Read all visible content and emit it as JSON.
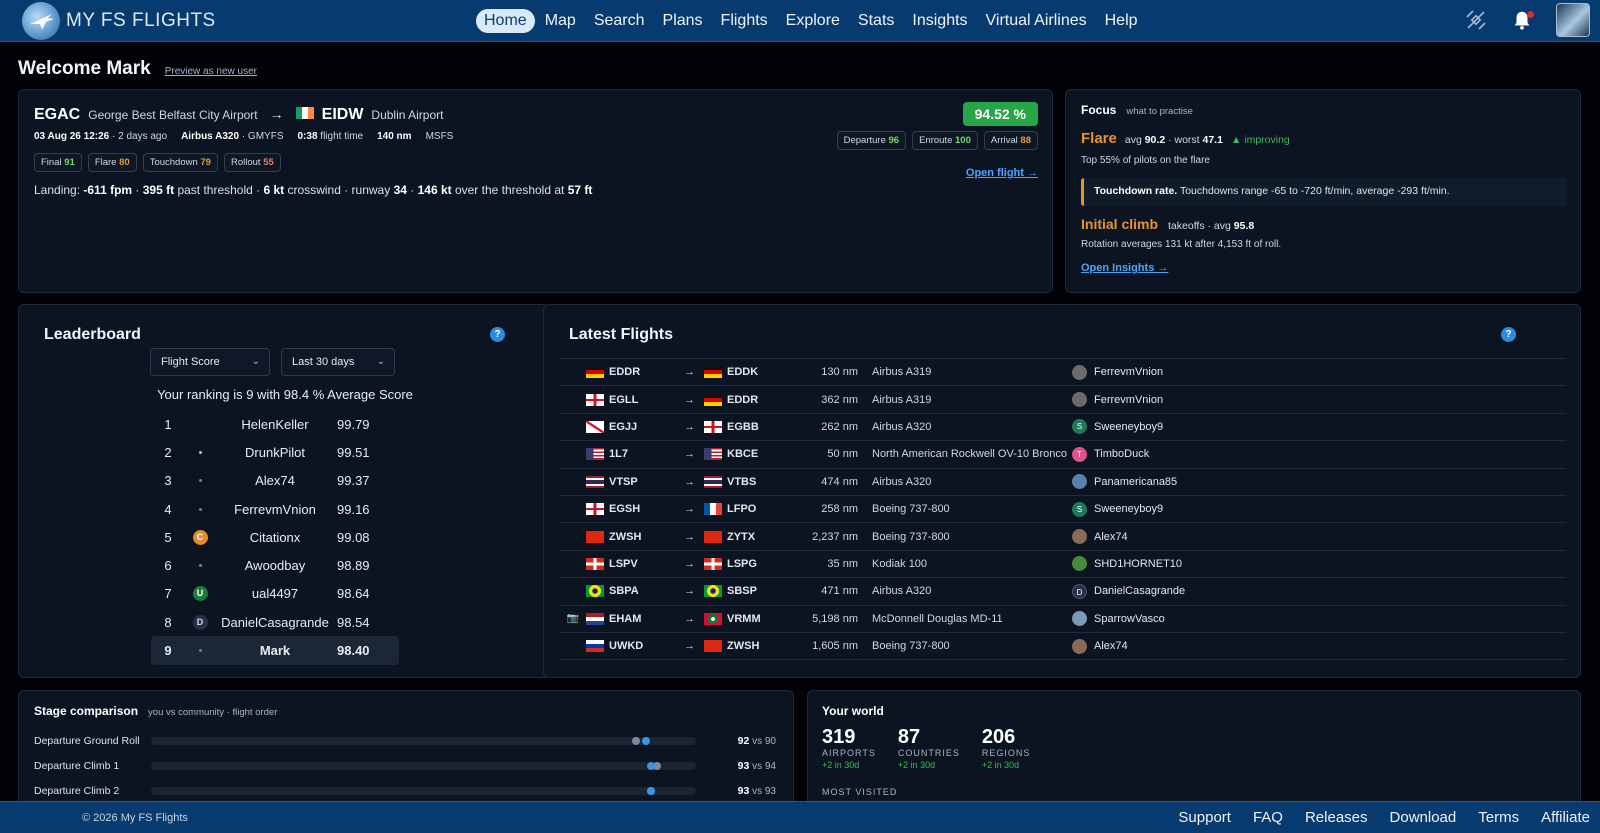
{
  "app": {
    "name": "MY FS FLIGHTS"
  },
  "nav": {
    "items": [
      "Home",
      "Map",
      "Search",
      "Plans",
      "Flights",
      "Explore",
      "Stats",
      "Insights",
      "Virtual Airlines",
      "Help"
    ],
    "active": "Home"
  },
  "welcome": {
    "title": "Welcome Mark",
    "link": "Preview as new user"
  },
  "last_flight": {
    "from_icao": "EGAC",
    "from_name": "George Best Belfast City Airport",
    "to_icao": "EIDW",
    "to_name": "Dublin Airport",
    "date": "03 Aug 26 12:26",
    "ago": "· 2 days ago",
    "aircraft": "Airbus A320",
    "reg": "· GMYFS",
    "duration": "0:38",
    "duration_label": "flight time",
    "distance": "140 nm",
    "sim": "MSFS",
    "score": "94.52 %",
    "chips": [
      {
        "label": "Final",
        "value": "91",
        "tone": "g"
      },
      {
        "label": "Flare",
        "value": "80",
        "tone": "o"
      },
      {
        "label": "Touchdown",
        "value": "79",
        "tone": "o"
      },
      {
        "label": "Rollout",
        "value": "55",
        "tone": "r"
      }
    ],
    "phases": [
      {
        "label": "Departure",
        "value": "96",
        "tone": "g"
      },
      {
        "label": "Enroute",
        "value": "100",
        "tone": "g"
      },
      {
        "label": "Arrival",
        "value": "88",
        "tone": "o"
      }
    ],
    "landing": {
      "p1": "Landing: ",
      "fpm": "-611 fpm",
      "p2": " · ",
      "thr": "395 ft",
      "p3": " past threshold · ",
      "xw": "6 kt",
      "p4": " crosswind · runway ",
      "rwy": "34",
      "p5": " · ",
      "spd": "146 kt",
      "p6": " over the threshold at ",
      "alt": "57 ft"
    },
    "open_link": "Open flight →"
  },
  "focus": {
    "title": "Focus",
    "subtitle": "what to practise",
    "flare": {
      "name": "Flare",
      "avg_label": "avg",
      "avg": "90.2",
      "worst_label": "· worst",
      "worst": "47.1",
      "trend": "▲ improving"
    },
    "top": "Top 55% of pilots on the flare",
    "tip": {
      "bold": "Touchdown rate.",
      "text": " Touchdowns range -65 to -720 ft/min, average -293 ft/min."
    },
    "climb": {
      "name": "Initial climb",
      "text": "takeoffs · avg",
      "avg": "95.8"
    },
    "rotation": "Rotation averages 131 kt after 4,153 ft of roll.",
    "open_link": "Open Insights →"
  },
  "leaderboard": {
    "title": "Leaderboard",
    "metric": "Flight Score",
    "period": "Last 30 days",
    "ranking_text": "Your ranking is 9 with 98.4 % Average Score",
    "rows": [
      {
        "pos": "1",
        "name": "HelenKeller",
        "score": "99.79",
        "av": "none"
      },
      {
        "pos": "2",
        "name": "DrunkPilot",
        "score": "99.51",
        "av": "dot-y"
      },
      {
        "pos": "3",
        "name": "Alex74",
        "score": "99.37",
        "av": "dot"
      },
      {
        "pos": "4",
        "name": "FerrevmVnion",
        "score": "99.16",
        "av": "dot"
      },
      {
        "pos": "5",
        "name": "Citationx",
        "score": "99.08",
        "av": "C"
      },
      {
        "pos": "6",
        "name": "Awoodbay",
        "score": "98.89",
        "av": "dot"
      },
      {
        "pos": "7",
        "name": "ual4497",
        "score": "98.64",
        "av": "U"
      },
      {
        "pos": "8",
        "name": "DanielCasagrande",
        "score": "98.54",
        "av": "D"
      },
      {
        "pos": "9",
        "name": "Mark",
        "score": "98.40",
        "av": "dot"
      }
    ]
  },
  "latest_flights": {
    "title": "Latest Flights",
    "rows": [
      {
        "cam": "",
        "from": "EDDR",
        "fromFlag": "de",
        "to": "EDDK",
        "toFlag": "de",
        "dist": "130 nm",
        "aircraft": "Airbus A319",
        "pilot": "FerrevmVnion",
        "pav": "img"
      },
      {
        "cam": "",
        "from": "EGLL",
        "fromFlag": "en",
        "to": "EDDR",
        "toFlag": "de",
        "dist": "362 nm",
        "aircraft": "Airbus A319",
        "pilot": "FerrevmVnion",
        "pav": "img"
      },
      {
        "cam": "",
        "from": "EGJJ",
        "fromFlag": "je",
        "to": "EGBB",
        "toFlag": "en",
        "dist": "262 nm",
        "aircraft": "Airbus A320",
        "pilot": "Sweeneyboy9",
        "pav": "S"
      },
      {
        "cam": "",
        "from": "1L7",
        "fromFlag": "us",
        "to": "KBCE",
        "toFlag": "us",
        "dist": "50 nm",
        "aircraft": "North American Rockwell OV-10 Bronco",
        "pilot": "TimboDuck",
        "pav": "T"
      },
      {
        "cam": "",
        "from": "VTSP",
        "fromFlag": "th",
        "to": "VTBS",
        "toFlag": "th",
        "dist": "474 nm",
        "aircraft": "Airbus A320",
        "pilot": "Panamericana85",
        "pav": "img2"
      },
      {
        "cam": "",
        "from": "EGSH",
        "fromFlag": "en",
        "to": "LFPO",
        "toFlag": "fr",
        "dist": "258 nm",
        "aircraft": "Boeing 737-800",
        "pilot": "Sweeneyboy9",
        "pav": "S"
      },
      {
        "cam": "",
        "from": "ZWSH",
        "fromFlag": "cn",
        "to": "ZYTX",
        "toFlag": "cn",
        "dist": "2,237 nm",
        "aircraft": "Boeing 737-800",
        "pilot": "Alex74",
        "pav": "img3"
      },
      {
        "cam": "",
        "from": "LSPV",
        "fromFlag": "ch",
        "to": "LSPG",
        "toFlag": "ch",
        "dist": "35 nm",
        "aircraft": "Kodiak 100",
        "pilot": "SHD1HORNET10",
        "pav": "img4"
      },
      {
        "cam": "",
        "from": "SBPA",
        "fromFlag": "br",
        "to": "SBSP",
        "toFlag": "br",
        "dist": "471 nm",
        "aircraft": "Airbus A320",
        "pilot": "DanielCasagrande",
        "pav": "D"
      },
      {
        "cam": "📷",
        "from": "EHAM",
        "fromFlag": "nl",
        "to": "VRMM",
        "toFlag": "mv",
        "dist": "5,198 nm",
        "aircraft": "McDonnell Douglas MD-11",
        "pilot": "SparrowVasco",
        "pav": "img5"
      },
      {
        "cam": "",
        "from": "UWKD",
        "fromFlag": "ru",
        "to": "ZWSH",
        "toFlag": "cn",
        "dist": "1,605 nm",
        "aircraft": "Boeing 737-800",
        "pilot": "Alex74",
        "pav": "img3"
      }
    ]
  },
  "stage_comparison": {
    "title": "Stage comparison",
    "subtitle": "you vs community · flight order",
    "vs_label": "vs",
    "rows": [
      {
        "label": "Departure Ground Roll",
        "you": "92",
        "community": "90"
      },
      {
        "label": "Departure Climb 1",
        "you": "93",
        "community": "94"
      },
      {
        "label": "Departure Climb 2",
        "you": "93",
        "community": "93"
      }
    ]
  },
  "your_world": {
    "title": "Your world",
    "stats": [
      {
        "num": "319",
        "label": "AIRPORTS",
        "delta": "+2 in 30d"
      },
      {
        "num": "87",
        "label": "COUNTRIES",
        "delta": "+2 in 30d"
      },
      {
        "num": "206",
        "label": "REGIONS",
        "delta": "+2 in 30d"
      }
    ],
    "most_visited": "MOST VISITED"
  },
  "footer": {
    "copyright": "© 2026 My FS Flights",
    "links": [
      "Support",
      "FAQ",
      "Releases",
      "Download",
      "Terms",
      "Affiliate"
    ]
  },
  "colors": {
    "accent": "#073a6e",
    "score_green": "#27a649",
    "focus_orange": "#e8932e",
    "link": "#4ea3ff"
  }
}
